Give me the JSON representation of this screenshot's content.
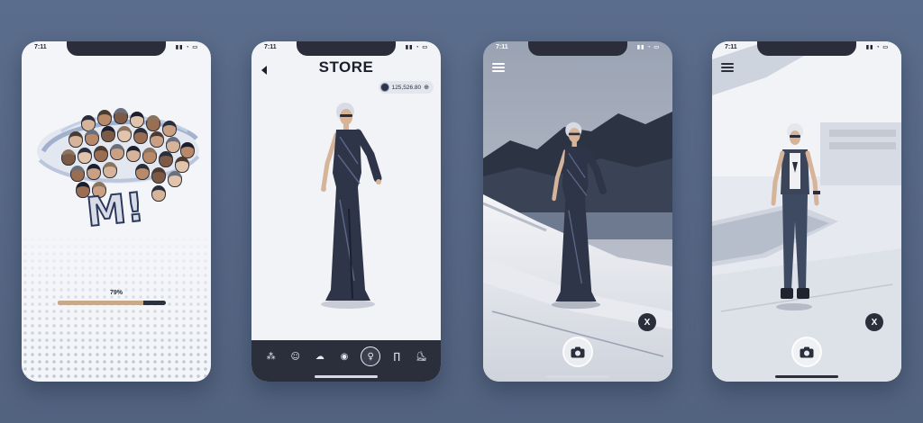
{
  "screens": [
    {
      "id": "loading",
      "status_time": "7:11",
      "logo_text": "M!",
      "progress": {
        "label": "79%",
        "value": 0.79
      }
    },
    {
      "id": "store",
      "status_time": "7:11",
      "title": "STORE",
      "balance": "125,526.80",
      "tabs": [
        {
          "icon": "swatches-icon",
          "glyph": "⁂"
        },
        {
          "icon": "face-icon",
          "glyph": "☺"
        },
        {
          "icon": "hair-icon",
          "glyph": "☁"
        },
        {
          "icon": "eye-icon",
          "glyph": "◉"
        },
        {
          "icon": "dress-icon",
          "glyph": "♀",
          "active": true
        },
        {
          "icon": "pants-icon",
          "glyph": "∏"
        },
        {
          "icon": "shoe-icon",
          "glyph": "⛸"
        }
      ]
    },
    {
      "id": "ar-boat",
      "status_time": "7:11",
      "close_label": "X"
    },
    {
      "id": "ar-desk",
      "status_time": "7:11",
      "close_label": "X"
    }
  ],
  "colors": {
    "background": "#56677f",
    "dark": "#2b2f3c",
    "progress_fill": "#c9a98b",
    "logo_stroke": "#2b3a5c"
  }
}
